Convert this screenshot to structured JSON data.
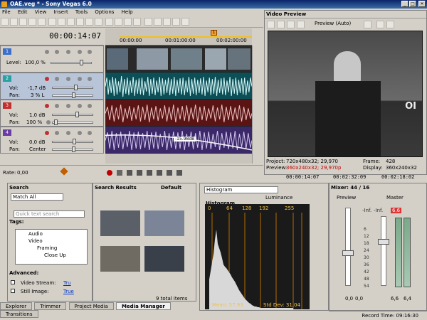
{
  "window": {
    "title": "OAE.veg * - Sony Vegas 6.0",
    "minimize": "_",
    "maximize": "□",
    "close": "✕"
  },
  "menu": [
    "File",
    "Edit",
    "View",
    "Insert",
    "Tools",
    "Options",
    "Help"
  ],
  "timecode": "00:00:14:07",
  "ruler": {
    "labels": [
      "00:00:00",
      "00:01:00:00",
      "00:02:00:00"
    ],
    "marker": "1"
  },
  "tracks": [
    {
      "num": "1",
      "color": "#3b6fc8",
      "label1": "Level:",
      "value1": "100,0 %"
    },
    {
      "num": "2",
      "color": "#2aa1a1",
      "label1": "Vol:",
      "value1": "-1,7 dB",
      "label2": "Pan:",
      "value2": "3 % L"
    },
    {
      "num": "3",
      "color": "#c03030",
      "label1": "Vol:",
      "value1": "1,0 dB",
      "label2": "Pan:",
      "value2": "100 %"
    },
    {
      "num": "4",
      "color": "#6a3ca8",
      "label1": "Vol:",
      "value1": "0,0 dB",
      "label2": "Pan:",
      "value2": "Center"
    }
  ],
  "envelope_tag": "-15.98dB",
  "rate": {
    "label": "Rate:",
    "value": "0,00"
  },
  "transport_times": [
    "00:00:14:07",
    "00:02:32:09",
    "00:02:18:02"
  ],
  "preview": {
    "title": "Video Preview",
    "mode": "Preview (Auto)",
    "project_label": "Project:",
    "project": "720x480x32; 29,970",
    "preview_label": "Preview:",
    "preview_val": "360x240x32; 29,970p",
    "frame_label": "Frame:",
    "frame": "428",
    "display_label": "Display:",
    "display": "360x240x32",
    "overlay": "OI"
  },
  "search": {
    "title": "Search",
    "scope": "Match All",
    "placeholder": "Quick text search",
    "tags_label": "Tags:",
    "tree": [
      "Audio",
      "Video",
      "Framing",
      "Close Up"
    ],
    "advanced_label": "Advanced:",
    "adv": [
      {
        "label": "Video Stream:",
        "value": "Tru"
      },
      {
        "label": "Still Image:",
        "value": "True"
      }
    ]
  },
  "results": {
    "title": "Search Results",
    "default_label": "Default",
    "count": "9 total items"
  },
  "tabs": [
    "Explorer",
    "Trimmer",
    "Project Media",
    "Media Manager",
    "Transitions"
  ],
  "histogram": {
    "mode": "Histogram",
    "channel": "Luminance",
    "title": "Histogram",
    "ticks": [
      "0",
      "64",
      "128",
      "192",
      "255"
    ],
    "mean": "Mean: 57,93",
    "stddev": "Std Dev: 31,04"
  },
  "mixer": {
    "title": "Mixer: 44 / 16",
    "preview": "Preview",
    "master": "Master",
    "peak": "6.6",
    "left_peak": "-Inf.",
    "right_peak": "-Inf.",
    "bottom_vals": [
      "0,0",
      "0,0",
      "6,6",
      "6,4"
    ],
    "scale": [
      "6",
      "12",
      "18",
      "24",
      "30",
      "36",
      "42",
      "48",
      "54"
    ]
  },
  "status": {
    "record_time": "Record Time: 09:16:30"
  },
  "colors": {
    "title": "#0a246a",
    "video_lane": "#dfe0e6",
    "audio2": "#1e8f9a",
    "audio3": "#8f2424",
    "audio4": "#5a3a9a"
  }
}
